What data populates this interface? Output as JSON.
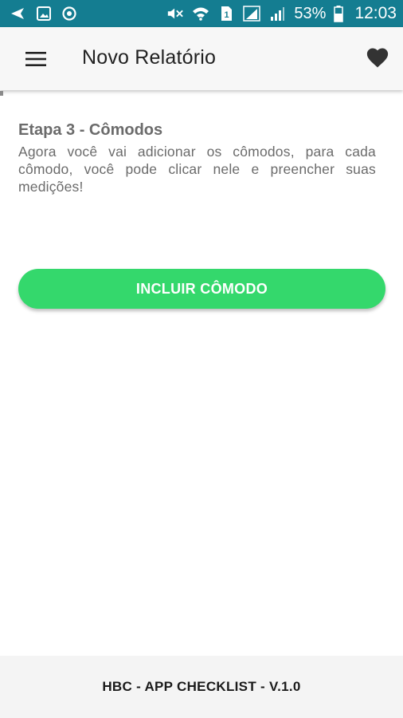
{
  "status_bar": {
    "icons_left": [
      "back-arrow-icon",
      "image-icon",
      "sync-icon"
    ],
    "icons_right": [
      "mute-icon",
      "wifi-icon",
      "sim-icon",
      "signal-icon",
      "signal-icon-2"
    ],
    "battery_percent": "53%",
    "time": "12:03",
    "background_color": "#147d91"
  },
  "app_bar": {
    "title": "Novo Relatório",
    "menu_icon": "hamburger-menu-icon",
    "favorite_icon": "heart-icon"
  },
  "content": {
    "step_title": "Etapa 3 - Cômodos",
    "step_description": "Agora você vai adicionar os cômodos, para cada cômodo, você pode clicar nele e preencher suas medições!",
    "add_room_button": "INCLUIR CÔMODO",
    "button_color": "#34d86c"
  },
  "footer": {
    "text": "HBC - APP CHECKLIST - V.1.0"
  }
}
